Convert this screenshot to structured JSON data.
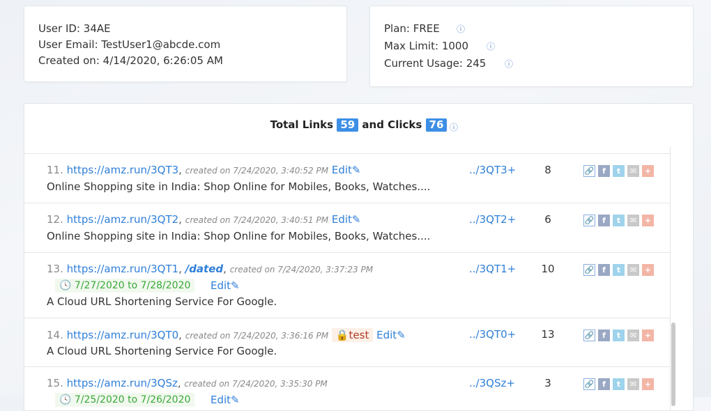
{
  "user": {
    "id_label": "User ID:",
    "id_value": "34AE",
    "email_label": "User Email:",
    "email_value": "TestUser1@abcde.com",
    "created_label": "Created on:",
    "created_value": "4/14/2020, 6:26:05 AM"
  },
  "plan": {
    "plan_label": "Plan:",
    "plan_value": "FREE",
    "max_label": "Max Limit:",
    "max_value": "1000",
    "usage_label": "Current Usage:",
    "usage_value": "245",
    "info_icon": "ⓘ"
  },
  "summary": {
    "links_label": "Total Links",
    "links_count": "59",
    "clicks_label": "and Clicks",
    "clicks_count": "76",
    "info_icon": "ⓘ"
  },
  "edit_label": "Edit✎",
  "rows": [
    {
      "num": "11.",
      "url": "https://amz.run/3QT3",
      "created": "created on 7/24/2020, 3:40:52 PM",
      "title": "Online Shopping site in India: Shop Online for Mobiles, Books, Watches....",
      "short": "../3QT3+",
      "clicks": "8"
    },
    {
      "num": "12.",
      "url": "https://amz.run/3QT2",
      "created": "created on 7/24/2020, 3:40:51 PM",
      "title": "Online Shopping site in India: Shop Online for Mobiles, Books, Watches....",
      "short": "../3QT2+",
      "clicks": "6"
    },
    {
      "num": "13.",
      "url": "https://amz.run/3QT1",
      "dated": "/dated",
      "created": "created on 7/24/2020, 3:37:23 PM",
      "date_range": "🕓 7/27/2020 to 7/28/2020",
      "title": "A Cloud URL Shortening Service For Google.",
      "short": "../3QT1+",
      "clicks": "10"
    },
    {
      "num": "14.",
      "url": "https://amz.run/3QT0",
      "created": "created on 7/24/2020, 3:36:16 PM",
      "password": "🔒test",
      "title": "A Cloud URL Shortening Service For Google.",
      "short": "../3QT0+",
      "clicks": "13"
    },
    {
      "num": "15.",
      "url": "https://amz.run/3QSz",
      "created": "created on 7/24/2020, 3:35:30 PM",
      "date_range": "🕓 7/25/2020 to 7/26/2020",
      "short": "../3QSz+",
      "clicks": "3"
    }
  ],
  "share_icons": {
    "link": "🔗",
    "facebook": "f",
    "twitter": "t",
    "email": "✉",
    "plus": "+"
  },
  "colors": {
    "accent": "#2f7fd8",
    "badge": "#3d8fe6",
    "date_green": "#3aa83a",
    "password_red": "#b13a2a"
  }
}
